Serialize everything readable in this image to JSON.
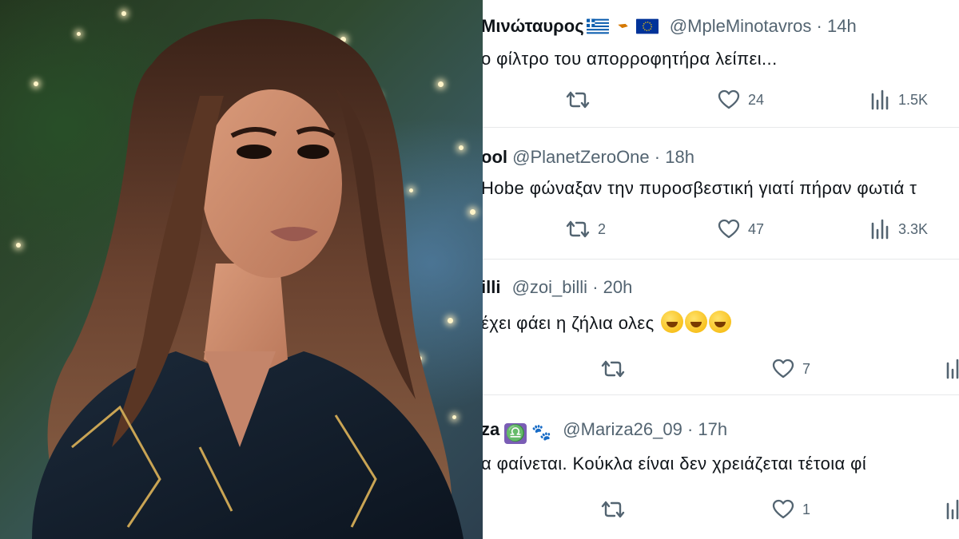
{
  "tweets": [
    {
      "name": "Μινώταυρος",
      "flags": [
        "greece-flag",
        "cyprus-flag",
        "eu-flag"
      ],
      "handle": "@MpleMinotavros",
      "sep": "·",
      "time": "14h",
      "text": "ο φίλτρο του απορροφητήρα λείπει...",
      "retweets": "",
      "likes": "24",
      "views": "1.5K"
    },
    {
      "name": "ool",
      "handle": "@PlanetZeroOne",
      "sep": "·",
      "time": "18h",
      "text": "Hobe φώναξαν την πυροσβεστική γιατί πήραν φωτιά τ",
      "retweets": "2",
      "likes": "47",
      "views": "3.3K"
    },
    {
      "name": "illi",
      "handle": "@zoi_billi",
      "sep": "·",
      "time": "20h",
      "text": "έχει φάει η ζήλια ολες",
      "emojis": [
        "rofl-emoji",
        "rofl-emoji",
        "rofl-emoji"
      ],
      "retweets": "",
      "likes": "7",
      "views": ""
    },
    {
      "name": "za",
      "badges": [
        "libra-icon",
        "paw-icon"
      ],
      "libra_glyph": "♎",
      "paw_glyph": "🐾",
      "handle": "@Mariza26_09",
      "sep": "·",
      "time": "17h",
      "text": "α φαίνεται. Κούκλα είναι δεν χρειάζεται τέτοια φί",
      "retweets": "",
      "likes": "1",
      "views": ""
    }
  ],
  "colors": {
    "text": "#0f1419",
    "muted": "#536471",
    "divider": "#e7e9ea"
  }
}
